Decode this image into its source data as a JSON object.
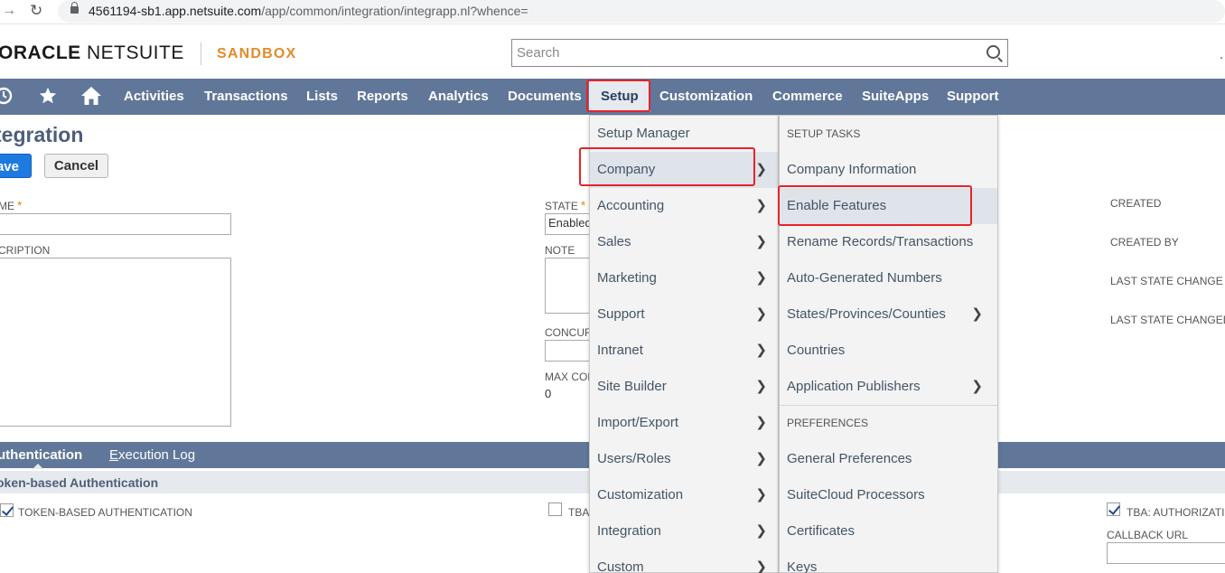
{
  "browser": {
    "url_domain": "4561194-sb1.app.netsuite.com",
    "url_path": "/app/common/integration/integrapp.nl?whence="
  },
  "header": {
    "logo_bold": "ORACLE",
    "logo_light": " NETSUITE",
    "environment": "SANDBOX",
    "search_placeholder": "Search",
    "more": "."
  },
  "nav": {
    "items": [
      "Activities",
      "Transactions",
      "Lists",
      "Reports",
      "Analytics",
      "Documents",
      "Setup",
      "Customization",
      "Commerce",
      "SuiteApps",
      "Support"
    ],
    "active": "Setup"
  },
  "page": {
    "title": "Integration",
    "title_visible": "tegration",
    "save_label": "ave",
    "cancel_label": "Cancel",
    "fields": {
      "name_label": "ME",
      "description_label": "CRIPTION",
      "state_label": "STATE",
      "state_value": "Enabled",
      "note_label": "NOTE",
      "concurrency_label": "CONCUR",
      "max_concurrency_label": "MAX CON",
      "max_concurrency_value": "0",
      "created_label": "CREATED",
      "created_by_label": "CREATED BY",
      "last_state_change_label": "LAST STATE CHANGE",
      "last_state_changed_label": "LAST STATE CHANGED"
    }
  },
  "subtabs": {
    "authentication": "uthentication",
    "execution_log": "Execution Log",
    "section_title": "oken-based Authentication",
    "tba_label": "TOKEN-BASED AUTHENTICATION",
    "tba_checked": true,
    "tbas_label": "TBA",
    "tbas_checked": false,
    "tba_auth_label": "TBA: AUTHORIZATIO",
    "tba_auth_checked": true,
    "callback_label": "CALLBACK URL"
  },
  "menu": {
    "items": [
      {
        "label": "Setup Manager",
        "has_sub": false
      },
      {
        "label": "Company",
        "has_sub": true
      },
      {
        "label": "Accounting",
        "has_sub": true
      },
      {
        "label": "Sales",
        "has_sub": true
      },
      {
        "label": "Marketing",
        "has_sub": true
      },
      {
        "label": "Support",
        "has_sub": true
      },
      {
        "label": "Intranet",
        "has_sub": true
      },
      {
        "label": "Site Builder",
        "has_sub": true
      },
      {
        "label": "Import/Export",
        "has_sub": true
      },
      {
        "label": "Users/Roles",
        "has_sub": true
      },
      {
        "label": "Customization",
        "has_sub": true
      },
      {
        "label": "Integration",
        "has_sub": true
      },
      {
        "label": "Custom",
        "has_sub": true
      }
    ],
    "selected": "Company"
  },
  "submenu": {
    "setup_tasks_header": "SETUP TASKS",
    "preferences_header": "PREFERENCES",
    "setup_tasks": [
      {
        "label": "Company Information",
        "has_sub": false
      },
      {
        "label": "Enable Features",
        "has_sub": false
      },
      {
        "label": "Rename Records/Transactions",
        "has_sub": false
      },
      {
        "label": "Auto-Generated Numbers",
        "has_sub": false
      },
      {
        "label": "States/Provinces/Counties",
        "has_sub": true
      },
      {
        "label": "Countries",
        "has_sub": false
      },
      {
        "label": "Application Publishers",
        "has_sub": true
      }
    ],
    "preferences": [
      {
        "label": "General Preferences",
        "has_sub": false
      },
      {
        "label": "SuiteCloud Processors",
        "has_sub": false
      },
      {
        "label": "Certificates",
        "has_sub": false
      },
      {
        "label": "Keys",
        "has_sub": false
      }
    ],
    "selected": "Enable Features"
  },
  "colors": {
    "nav_bg": "#607799",
    "highlight": "#e8222a",
    "sandbox": "#e28b29",
    "save_btn": "#1f7ae0"
  }
}
